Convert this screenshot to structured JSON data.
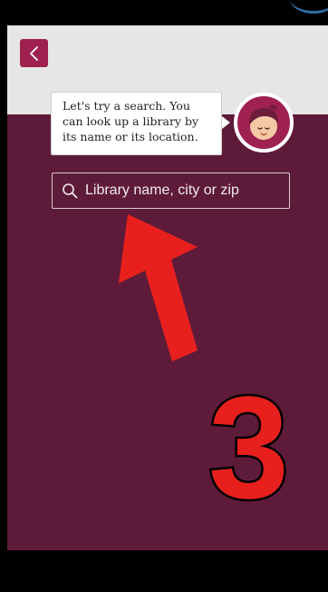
{
  "tutorial": {
    "bubble_text": "Let's try a search. You can look up a library by its name or its location."
  },
  "search": {
    "placeholder": "Library name, city or zip"
  },
  "annotation": {
    "step_number": "3"
  },
  "colors": {
    "header_bg": "#e6e6e6",
    "brand": "#9e2150",
    "page_bg": "#5e1b39",
    "annotation_red": "#e8201d"
  },
  "icons": {
    "back": "chevron-left-icon",
    "search": "search-icon",
    "avatar": "mascot-avatar-icon",
    "arrow": "red-arrow-annotation"
  }
}
